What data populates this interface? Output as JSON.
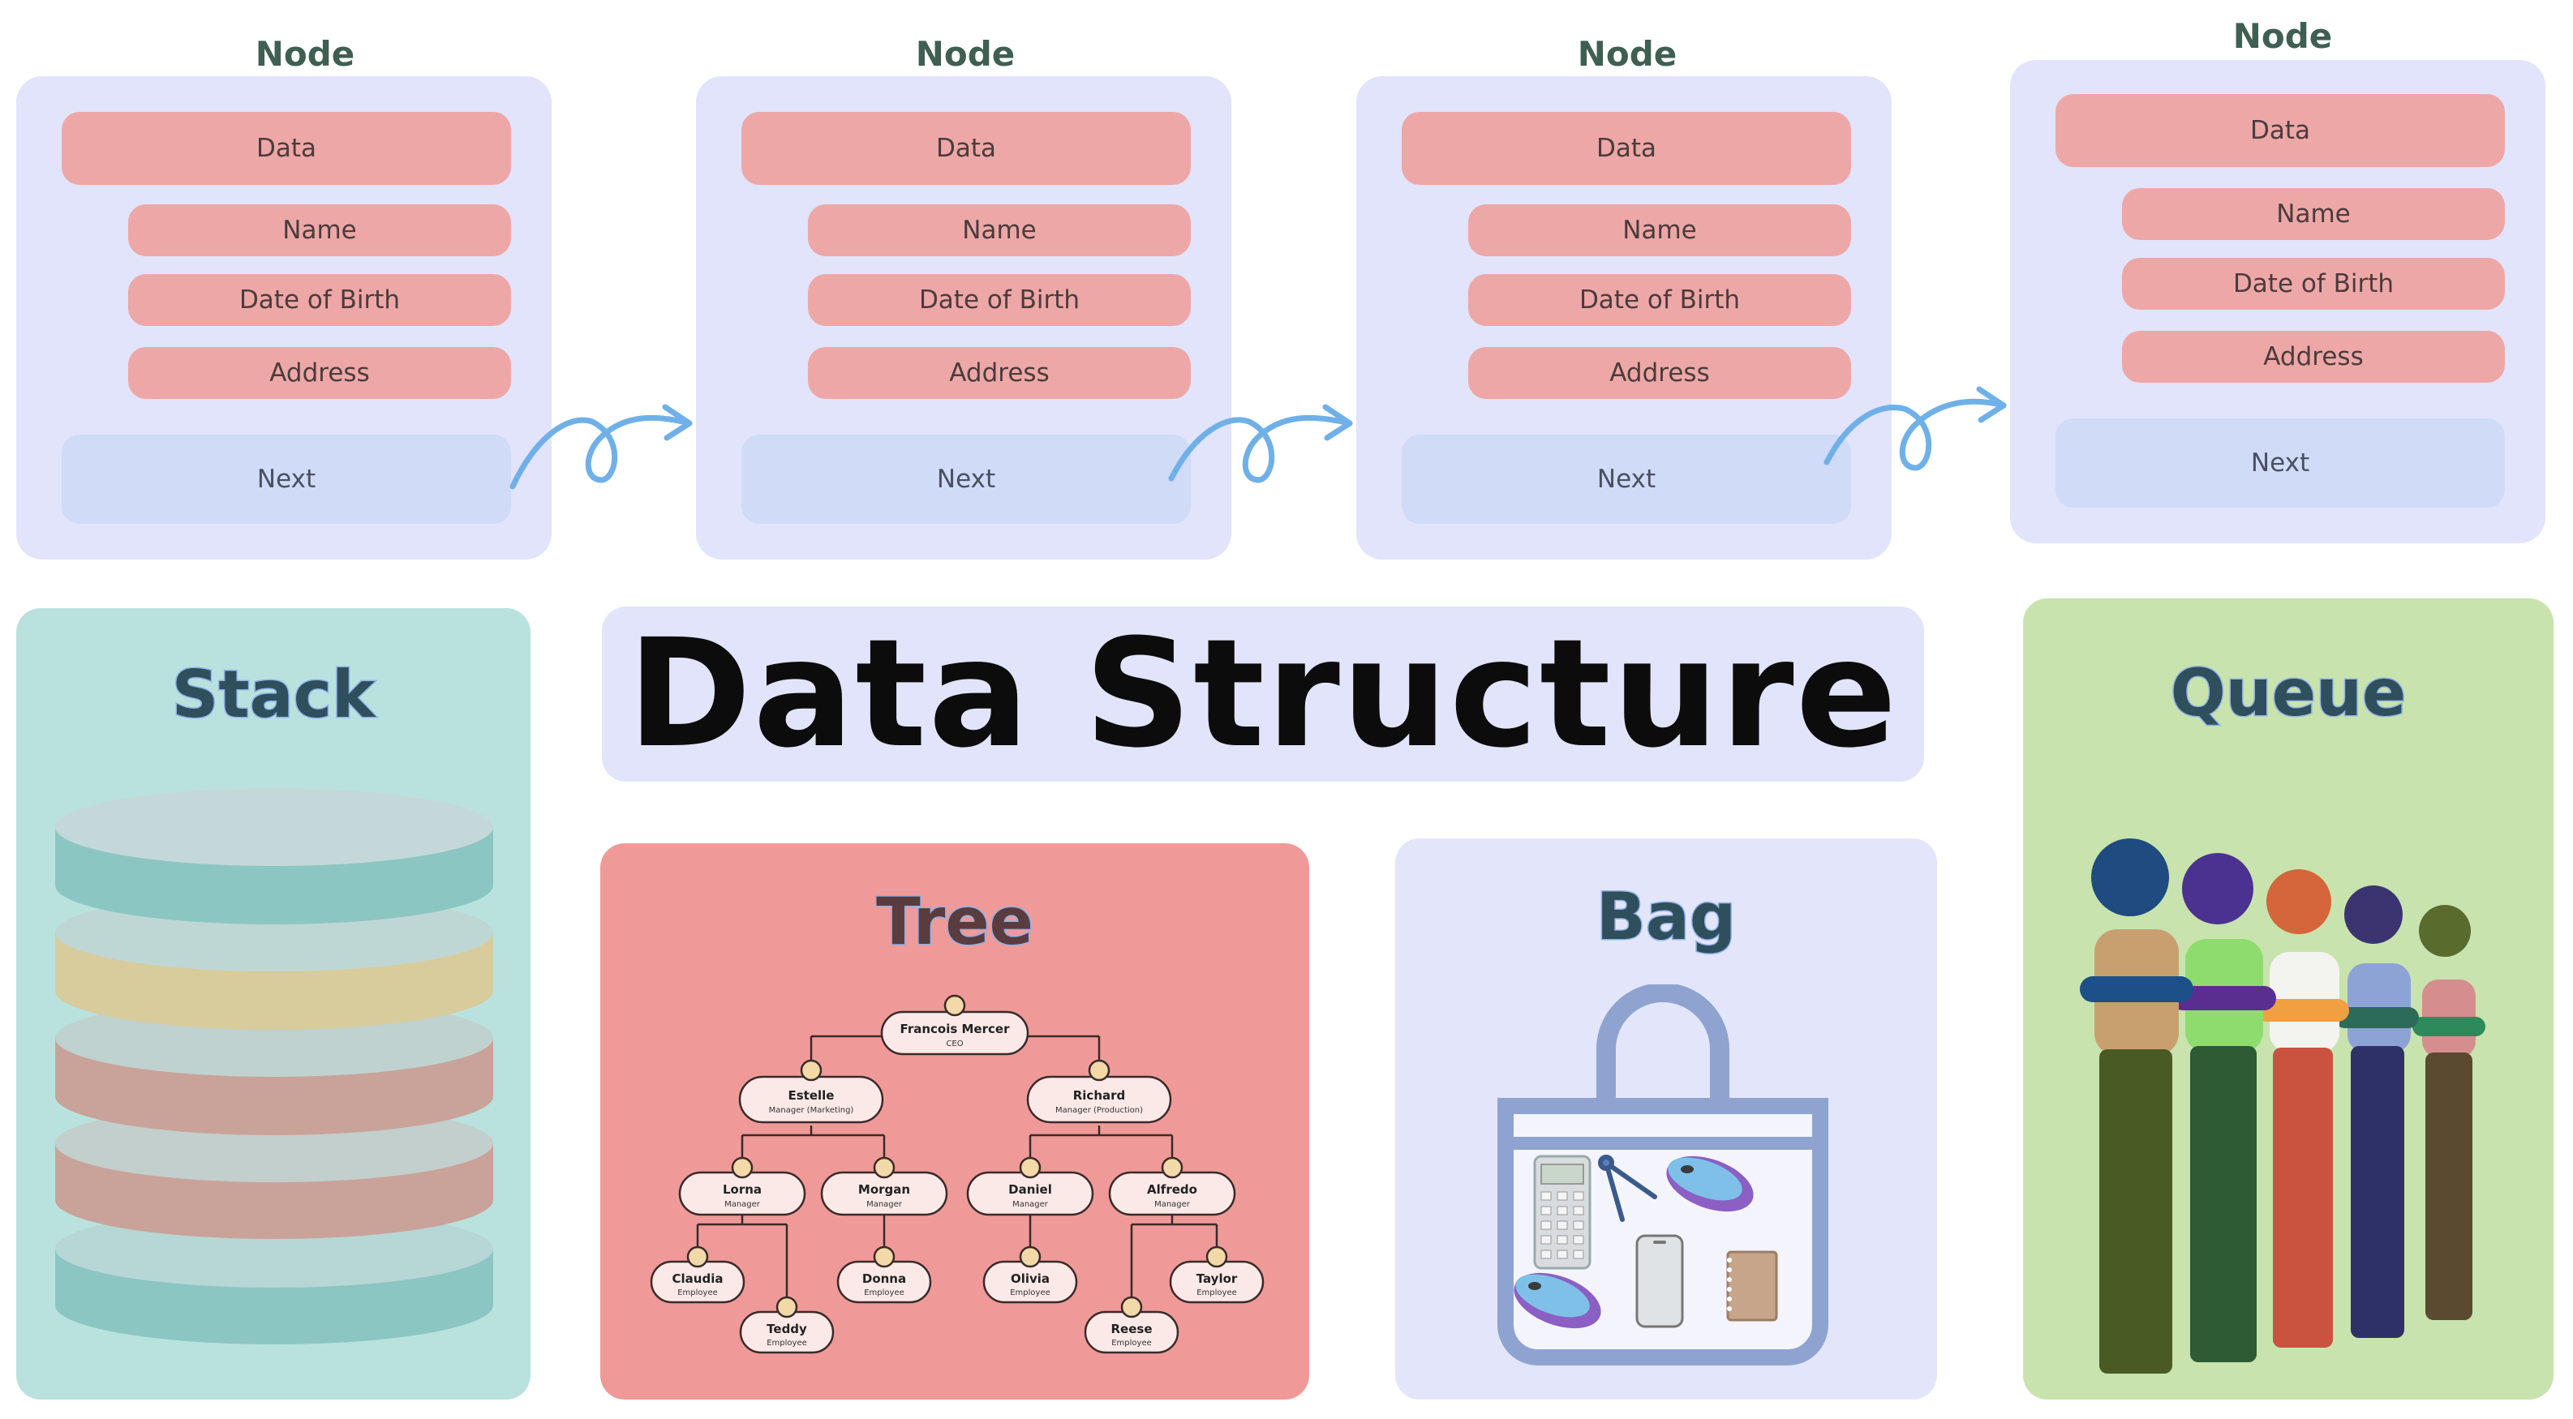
{
  "nodes": [
    {
      "title": "Node",
      "data": "Data",
      "fields": [
        "Name",
        "Date of Birth",
        "Address"
      ],
      "next": "Next"
    },
    {
      "title": "Node",
      "data": "Data",
      "fields": [
        "Name",
        "Date of Birth",
        "Address"
      ],
      "next": "Next"
    },
    {
      "title": "Node",
      "data": "Data",
      "fields": [
        "Name",
        "Date of Birth",
        "Address"
      ],
      "next": "Next"
    },
    {
      "title": "Node",
      "data": "Data",
      "fields": [
        "Name",
        "Date of Birth",
        "Address"
      ],
      "next": "Next"
    }
  ],
  "main_title": "Data Structure",
  "stack": {
    "title": "Stack",
    "layer_colors": [
      "#8cc6c2",
      "#d8cc9c",
      "#c9a39a",
      "#c9a39a",
      "#8cc6c2"
    ]
  },
  "tree": {
    "title": "Tree",
    "ceo": {
      "name": "Francois Mercer",
      "role": "CEO"
    },
    "managers": [
      {
        "name": "Estelle",
        "role": "Manager (Marketing)"
      },
      {
        "name": "Richard",
        "role": "Manager (Production)"
      }
    ],
    "leads": [
      {
        "name": "Lorna",
        "role": "Manager"
      },
      {
        "name": "Morgan",
        "role": "Manager"
      },
      {
        "name": "Daniel",
        "role": "Manager"
      },
      {
        "name": "Alfredo",
        "role": "Manager"
      }
    ],
    "employees": [
      {
        "name": "Claudia",
        "role": "Employee"
      },
      {
        "name": "Teddy",
        "role": "Employee"
      },
      {
        "name": "Donna",
        "role": "Employee"
      },
      {
        "name": "Olivia",
        "role": "Employee"
      },
      {
        "name": "Reese",
        "role": "Employee"
      },
      {
        "name": "Taylor",
        "role": "Employee"
      }
    ]
  },
  "bag": {
    "title": "Bag"
  },
  "queue": {
    "title": "Queue"
  },
  "colors": {
    "node_bg": "#e1e4fb",
    "field_pink": "#eea7a7",
    "next_blue": "#d0dbf8",
    "arrow": "#6fb0e8",
    "stack_bg": "#b9e2de",
    "tree_bg": "#ef9a98",
    "bag_bg": "#e3e6fb",
    "queue_bg": "#c8e3ad"
  }
}
